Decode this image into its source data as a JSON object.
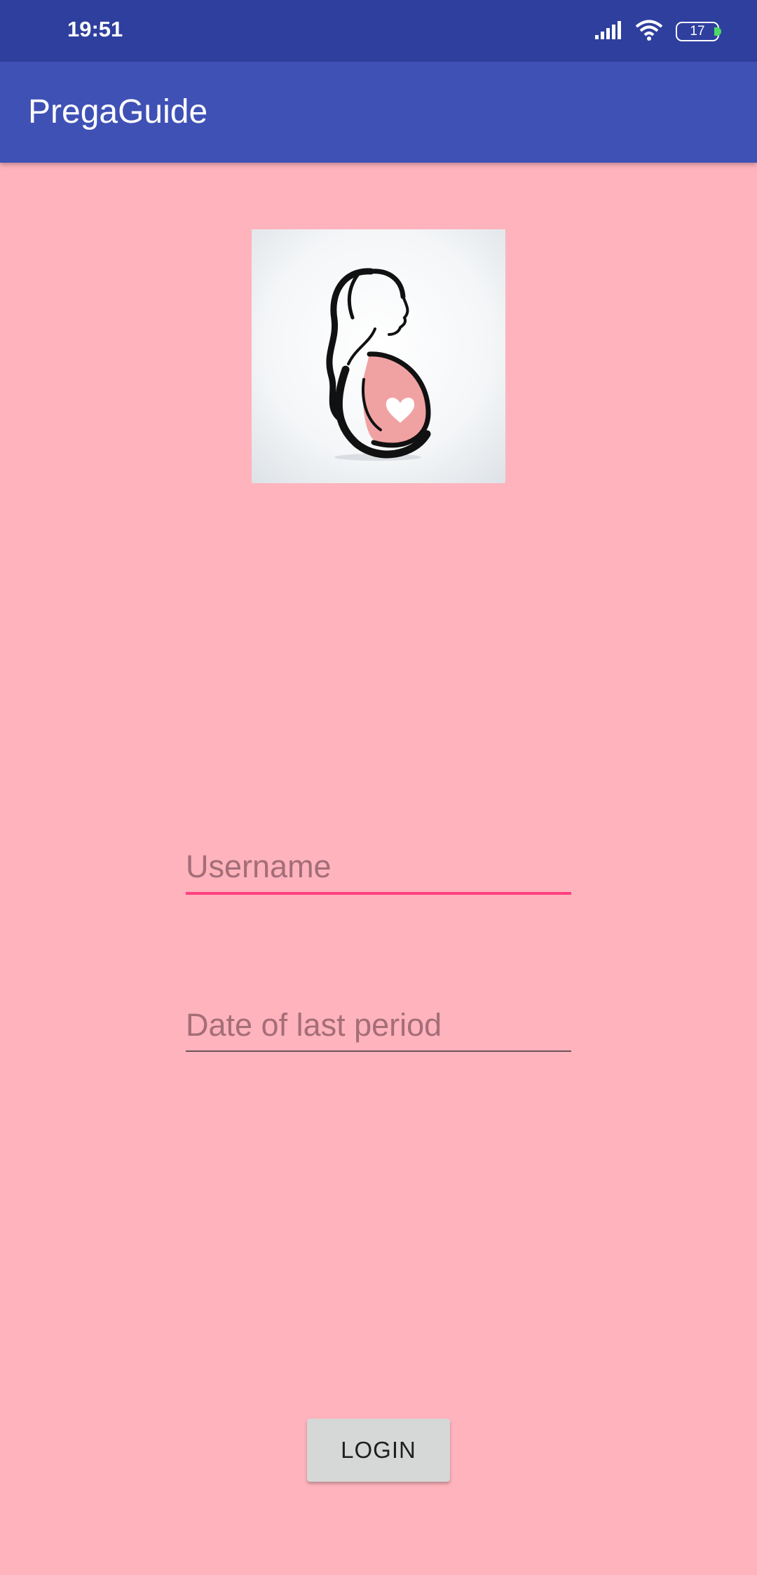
{
  "status_bar": {
    "time": "19:51",
    "battery_level": "17",
    "icons": [
      "signal-icon",
      "wifi-icon",
      "battery-icon"
    ],
    "background_color": "#2f3f9e"
  },
  "app_bar": {
    "title": "PregaGuide",
    "background_color": "#3f51b5"
  },
  "logo": {
    "icon": "pregnant-woman-logo-icon"
  },
  "form": {
    "username": {
      "value": "",
      "placeholder": "Username"
    },
    "last_period": {
      "value": "",
      "placeholder": "Date of last period"
    },
    "login_label": "LOGIN"
  },
  "colors": {
    "background": "#ffb3bd",
    "accent": "#ff4081"
  }
}
